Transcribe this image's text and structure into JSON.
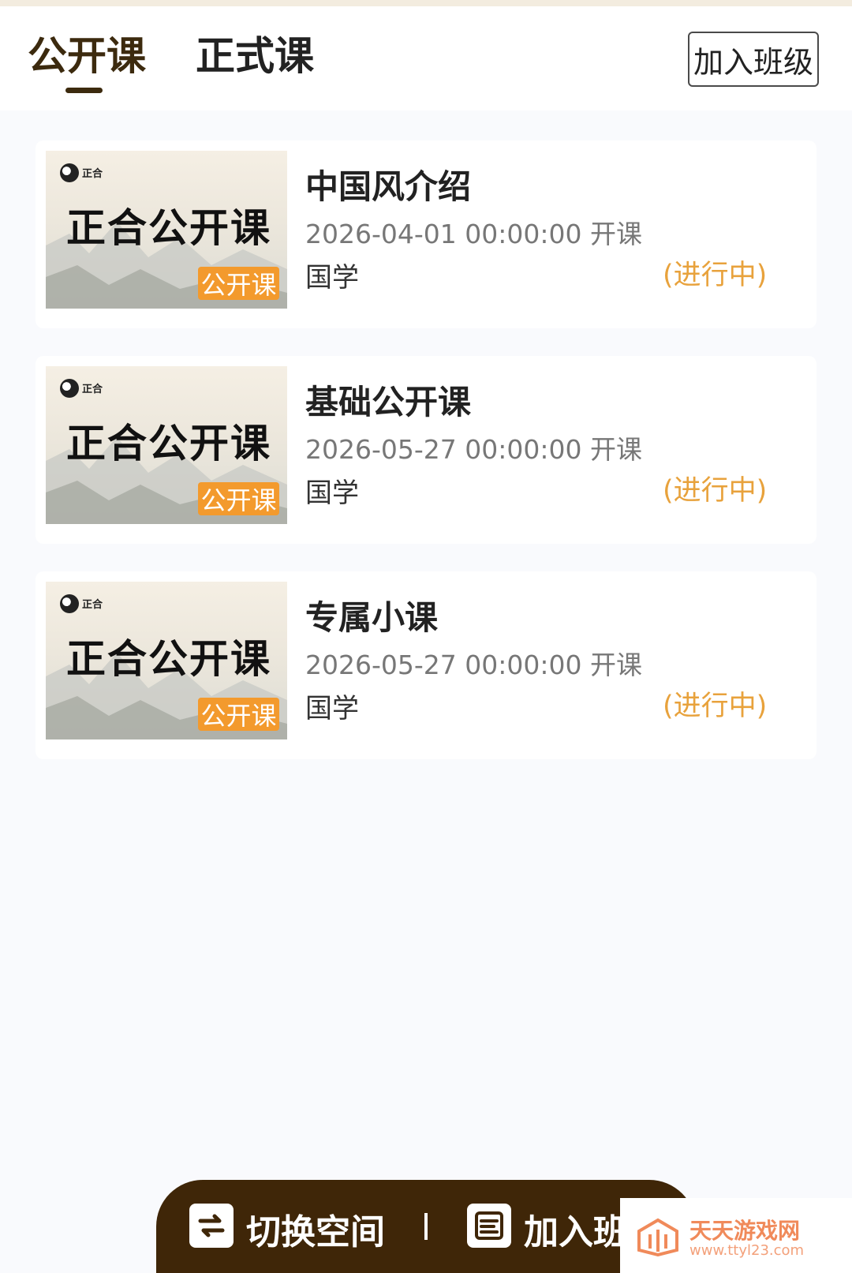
{
  "header": {
    "tabs": [
      {
        "label": "公开课",
        "active": true
      },
      {
        "label": "正式课",
        "active": false
      }
    ],
    "join_button": "加入班级"
  },
  "thumbnail": {
    "logo_text": "正合",
    "title": "正合公开课",
    "badge": "公开课"
  },
  "courses": [
    {
      "title": "中国风介绍",
      "date": "2026-04-01 00:00:00 开课",
      "category": "国学",
      "status": "(进行中)"
    },
    {
      "title": "基础公开课",
      "date": "2026-05-27 00:00:00 开课",
      "category": "国学",
      "status": "(进行中)"
    },
    {
      "title": "专属小课",
      "date": "2026-05-27 00:00:00 开课",
      "category": "国学",
      "status": "(进行中)"
    }
  ],
  "bottom_bar": {
    "switch_label": "切换空间",
    "join_label": "加入班"
  },
  "watermark": {
    "name": "天天游戏网",
    "url": "www.ttyl23.com"
  },
  "colors": {
    "accent_brown": "#3f2608",
    "status_orange": "#e8a23c",
    "badge_orange": "#f39a2d"
  }
}
